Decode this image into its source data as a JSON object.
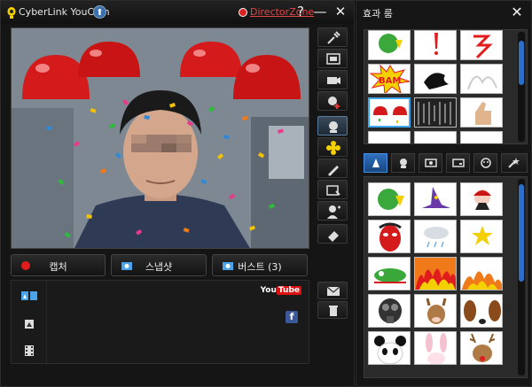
{
  "main_window": {
    "title": "CyberLink YouCam",
    "director_zone": "DirectorZone",
    "help_label": "?",
    "minimize_label": "—",
    "close_label": "✕"
  },
  "actions": {
    "capture": "캡처",
    "snapshot": "스냅샷",
    "burst": "버스트 (3)"
  },
  "gallery": {
    "youtube_you": "You",
    "youtube_tube": "Tube",
    "facebook": "f"
  },
  "effects_window": {
    "title": "효과 룸",
    "close_label": "✕"
  },
  "icons": {
    "side_tools": [
      "tools-icon",
      "fullscreen-icon",
      "webcam-settings-icon",
      "add-effect-icon",
      "effects-room-icon",
      "flower-frame-icon",
      "pen-icon",
      "scene-icon",
      "avatar-icon",
      "eraser-icon"
    ],
    "fx_tabs": [
      "magic-hat-tab-icon",
      "emotion-tab-icon",
      "frame-tab-icon",
      "scene-tab-icon",
      "face-tab-icon",
      "sparkle-tab-icon"
    ]
  },
  "colors": {
    "accent": "#3fa9f5",
    "dz_red": "#e04848",
    "tab_active": "#2f6fc0"
  }
}
